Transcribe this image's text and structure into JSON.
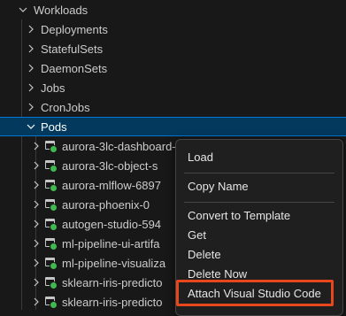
{
  "tree": {
    "workloads_label": "Workloads",
    "groups": [
      {
        "label": "Deployments"
      },
      {
        "label": "StatefulSets"
      },
      {
        "label": "DaemonSets"
      },
      {
        "label": "Jobs"
      },
      {
        "label": "CronJobs"
      }
    ],
    "pods_label": "Pods",
    "pods": [
      {
        "label": "aurora-3lc-dashboard-"
      },
      {
        "label": "aurora-3lc-object-s"
      },
      {
        "label": "aurora-mlflow-6897"
      },
      {
        "label": "aurora-phoenix-0"
      },
      {
        "label": "autogen-studio-594"
      },
      {
        "label": "ml-pipeline-ui-artifa"
      },
      {
        "label": "ml-pipeline-visualiza"
      },
      {
        "label": "sklearn-iris-predicto"
      },
      {
        "label": "sklearn-iris-predicto"
      }
    ]
  },
  "context_menu": {
    "items": {
      "load": "Load",
      "copy_name": "Copy Name",
      "convert_to_template": "Convert to Template",
      "get": "Get",
      "delete": "Delete",
      "delete_now": "Delete Now",
      "attach_vscode": "Attach Visual Studio Code"
    }
  },
  "colors": {
    "background": "#181818",
    "selection": "#04395e",
    "selection_border": "#0078d4",
    "pod_status_running": "#3fb950",
    "callout": "#e8471d"
  }
}
